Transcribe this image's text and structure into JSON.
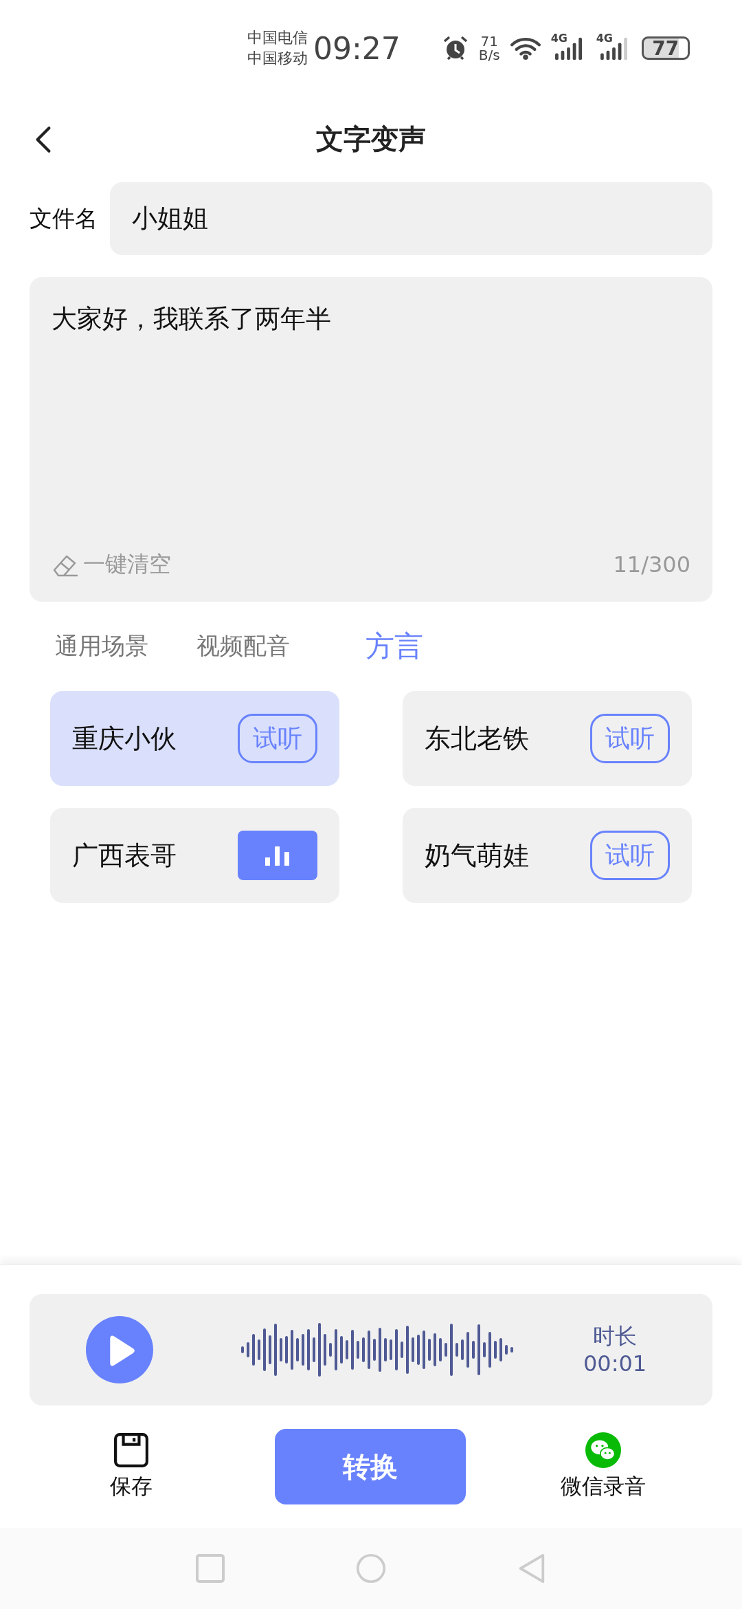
{
  "status_bar": {
    "carriers": [
      "中国电信",
      "中国移动"
    ],
    "time": "09:27",
    "speed_value": "71",
    "speed_unit": "B/s",
    "network_types": [
      "4G",
      "4G"
    ],
    "battery": "77"
  },
  "header": {
    "title": "文字变声"
  },
  "filename": {
    "label": "文件名",
    "value": "小姐姐"
  },
  "text_input": {
    "value": "大家好，我联系了两年半",
    "clear_label": "一键清空",
    "count": "11/300"
  },
  "tabs": [
    {
      "label": "通用场景",
      "selected": false
    },
    {
      "label": "视频配音",
      "selected": false
    },
    {
      "label": "方言",
      "selected": true
    }
  ],
  "voices": [
    {
      "name": "重庆小伙",
      "selected": true,
      "playing": false,
      "preview_label": "试听"
    },
    {
      "name": "东北老铁",
      "selected": false,
      "playing": false,
      "preview_label": "试听"
    },
    {
      "name": "广西表哥",
      "selected": false,
      "playing": true
    },
    {
      "name": "奶气萌娃",
      "selected": false,
      "playing": false,
      "preview_label": "试听"
    }
  ],
  "player": {
    "duration_label": "时长",
    "duration": "00:01"
  },
  "actions": {
    "save_label": "保存",
    "convert_label": "转换",
    "wechat_label": "微信录音"
  }
}
